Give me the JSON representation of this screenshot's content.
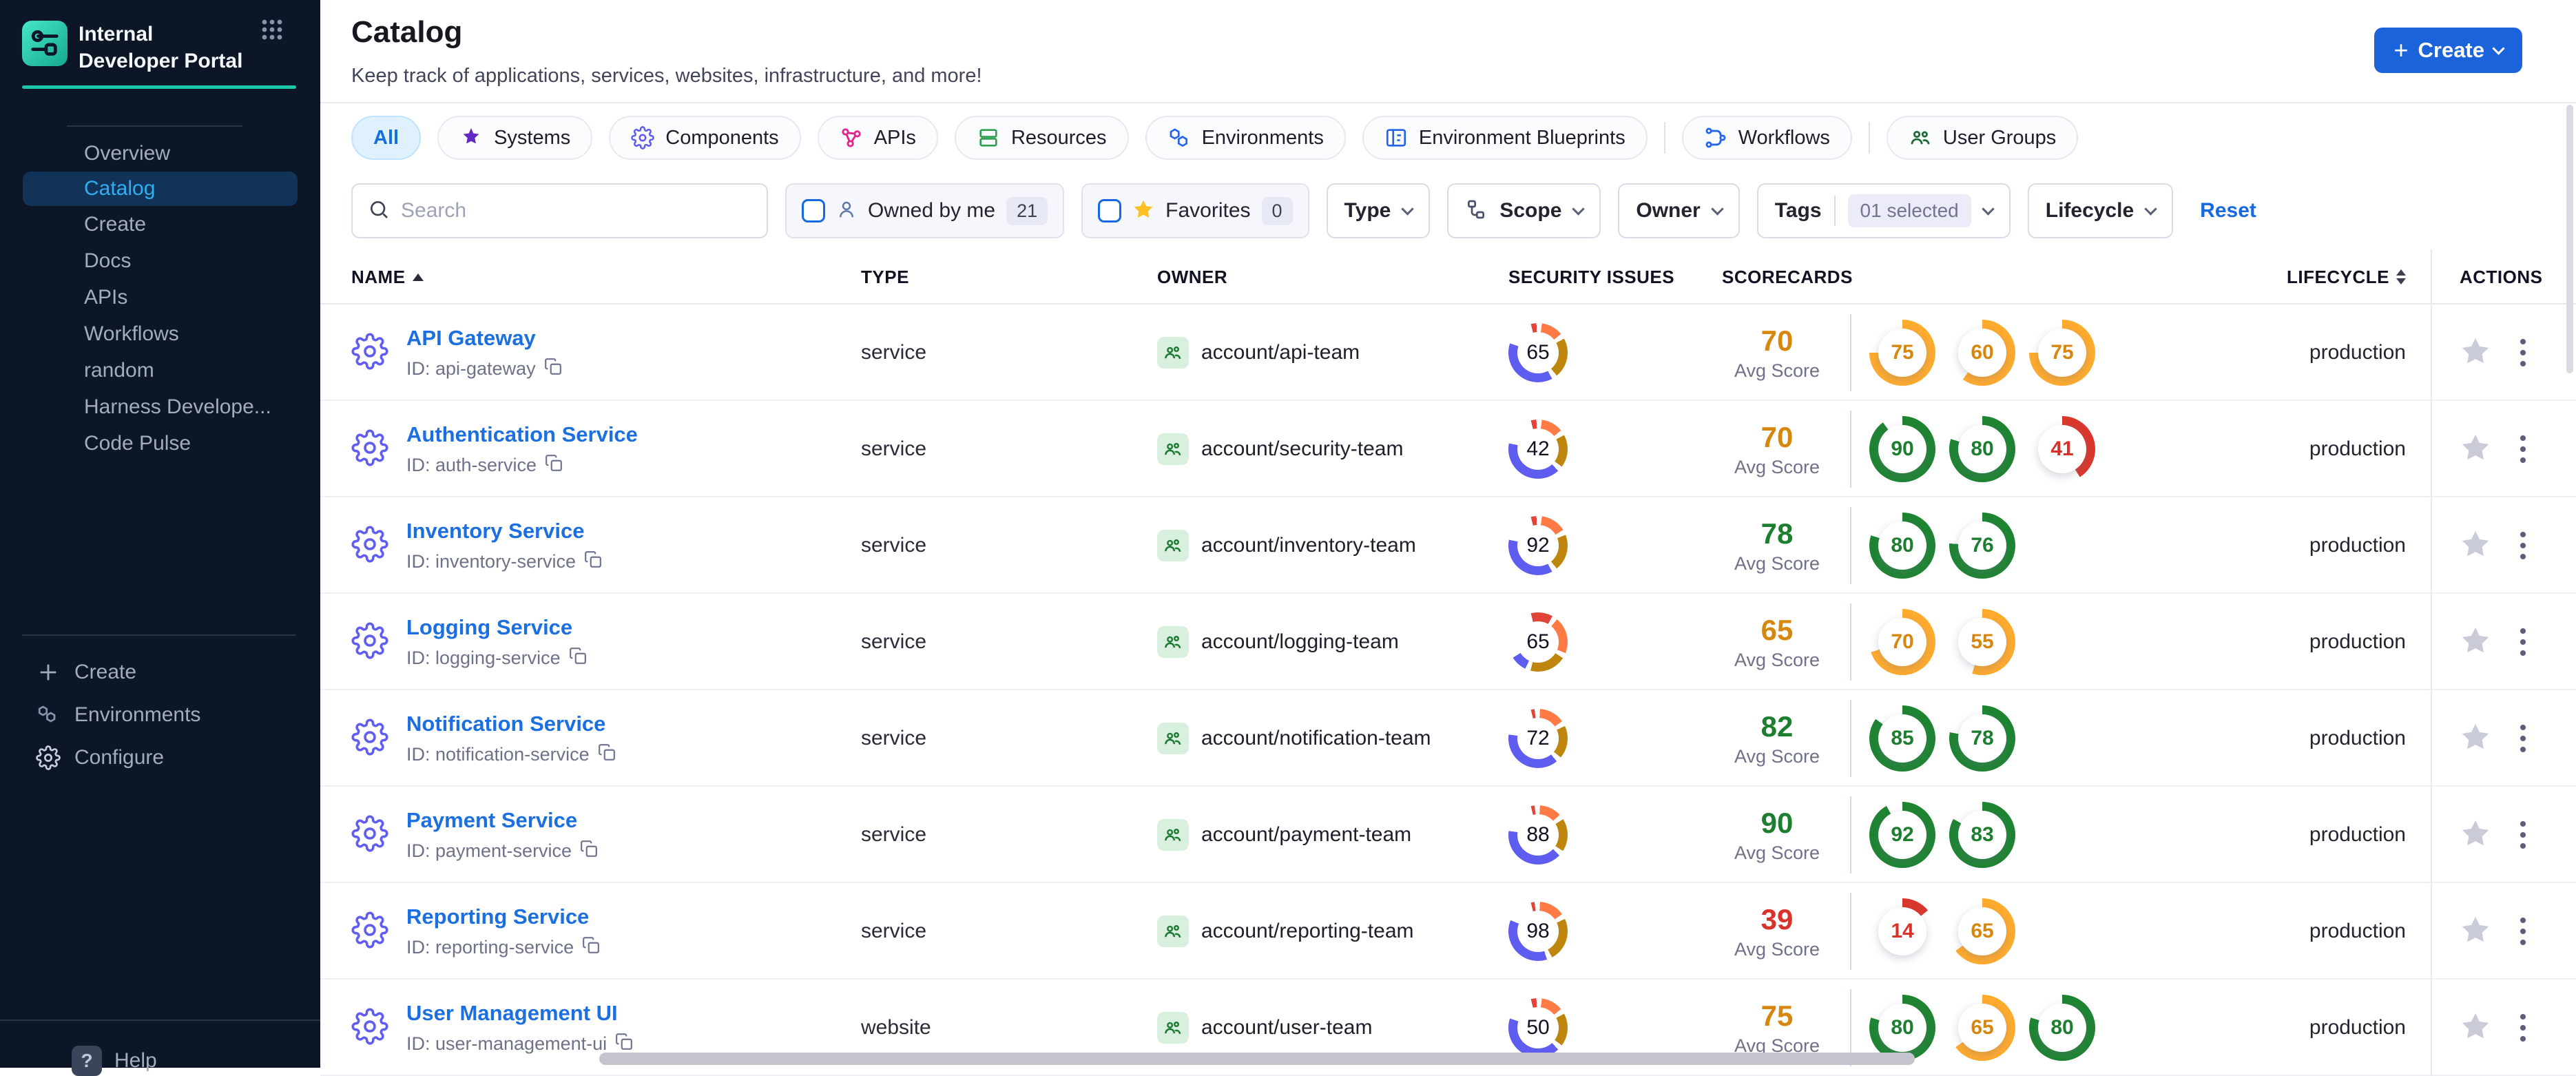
{
  "sidebar": {
    "logo_title": "Internal Developer Portal",
    "items": [
      {
        "label": "Overview",
        "active": false
      },
      {
        "label": "Catalog",
        "active": true
      },
      {
        "label": "Create",
        "active": false
      },
      {
        "label": "Docs",
        "active": false
      },
      {
        "label": "APIs",
        "active": false
      },
      {
        "label": "Workflows",
        "active": false
      },
      {
        "label": "random",
        "active": false
      },
      {
        "label": "Harness Develope...",
        "active": false
      },
      {
        "label": "Code Pulse",
        "active": false
      }
    ],
    "bottom_items": [
      {
        "icon": "plus-icon",
        "label": "Create"
      },
      {
        "icon": "hexagons-icon",
        "label": "Environments"
      },
      {
        "icon": "gear-icon",
        "label": "Configure"
      }
    ],
    "help_label": "Help"
  },
  "header": {
    "title": "Catalog",
    "subtitle": "Keep track of applications, services, websites, infrastructure, and more!",
    "create_label": "Create"
  },
  "tabs": [
    {
      "label": "All",
      "icon": "",
      "active": true,
      "divider_before": false
    },
    {
      "label": "Systems",
      "icon": "systems",
      "active": false,
      "divider_before": false
    },
    {
      "label": "Components",
      "icon": "components",
      "active": false,
      "divider_before": false
    },
    {
      "label": "APIs",
      "icon": "apis",
      "active": false,
      "divider_before": false
    },
    {
      "label": "Resources",
      "icon": "resources",
      "active": false,
      "divider_before": false
    },
    {
      "label": "Environments",
      "icon": "environments",
      "active": false,
      "divider_before": false
    },
    {
      "label": "Environment Blueprints",
      "icon": "blueprints",
      "active": false,
      "divider_before": false
    },
    {
      "label": "Workflows",
      "icon": "workflows",
      "active": false,
      "divider_before": true
    },
    {
      "label": "User Groups",
      "icon": "usergroups",
      "active": false,
      "divider_before": true
    }
  ],
  "filters": {
    "search_placeholder": "Search",
    "owned_by_me": {
      "label": "Owned by me",
      "count": "21"
    },
    "favorites": {
      "label": "Favorites",
      "count": "0"
    },
    "type_label": "Type",
    "scope_label": "Scope",
    "owner_label": "Owner",
    "tags": {
      "label": "Tags",
      "value": "01 selected"
    },
    "lifecycle_label": "Lifecycle",
    "reset_label": "Reset"
  },
  "table": {
    "columns": {
      "name": "NAME",
      "type": "TYPE",
      "owner": "OWNER",
      "security": "SECURITY ISSUES",
      "scorecards": "SCORECARDS",
      "lifecycle": "LIFECYCLE",
      "actions": "ACTIONS"
    },
    "avg_label": "Avg Score",
    "rows": [
      {
        "name": "API Gateway",
        "id": "ID: api-gateway",
        "type": "service",
        "owner": "account/api-team",
        "security": 65,
        "segments": [
          [
            "red",
            3
          ],
          [
            "orange",
            12
          ],
          [
            "gold",
            22
          ],
          [
            "blue",
            38
          ]
        ],
        "avg": 70,
        "avg_color": "orange",
        "scorecards": [
          [
            75,
            "orange"
          ],
          [
            60,
            "orange"
          ],
          [
            75,
            "orange"
          ]
        ],
        "lifecycle": "production"
      },
      {
        "name": "Authentication Service",
        "id": "ID: auth-service",
        "type": "service",
        "owner": "account/security-team",
        "security": 42,
        "segments": [
          [
            "red",
            3
          ],
          [
            "orange",
            12
          ],
          [
            "gold",
            18
          ],
          [
            "blue",
            40
          ]
        ],
        "avg": 70,
        "avg_color": "orange",
        "scorecards": [
          [
            90,
            "green"
          ],
          [
            80,
            "green"
          ],
          [
            41,
            "red"
          ]
        ],
        "lifecycle": "production"
      },
      {
        "name": "Inventory Service",
        "id": "ID: inventory-service",
        "type": "service",
        "owner": "account/inventory-team",
        "security": 92,
        "segments": [
          [
            "red",
            3
          ],
          [
            "orange",
            14
          ],
          [
            "gold",
            20
          ],
          [
            "blue",
            36
          ]
        ],
        "avg": 78,
        "avg_color": "green",
        "scorecards": [
          [
            80,
            "green"
          ],
          [
            76,
            "green"
          ]
        ],
        "lifecycle": "production"
      },
      {
        "name": "Logging Service",
        "id": "ID: logging-service",
        "type": "service",
        "owner": "account/logging-team",
        "security": 65,
        "segments": [
          [
            "red",
            12
          ],
          [
            "orange",
            20
          ],
          [
            "gold",
            20
          ],
          [
            "blue",
            9
          ]
        ],
        "avg": 65,
        "avg_color": "orange",
        "scorecards": [
          [
            70,
            "orange"
          ],
          [
            55,
            "orange"
          ]
        ],
        "lifecycle": "production"
      },
      {
        "name": "Notification Service",
        "id": "ID: notification-service",
        "type": "service",
        "owner": "account/notification-team",
        "security": 72,
        "segments": [
          [
            "red",
            2
          ],
          [
            "orange",
            14
          ],
          [
            "gold",
            18
          ],
          [
            "blue",
            38
          ]
        ],
        "avg": 82,
        "avg_color": "green",
        "scorecards": [
          [
            85,
            "green"
          ],
          [
            78,
            "green"
          ]
        ],
        "lifecycle": "production"
      },
      {
        "name": "Payment Service",
        "id": "ID: payment-service",
        "type": "service",
        "owner": "account/payment-team",
        "security": 88,
        "segments": [
          [
            "red",
            2
          ],
          [
            "orange",
            12
          ],
          [
            "gold",
            18
          ],
          [
            "blue",
            40
          ]
        ],
        "avg": 90,
        "avg_color": "green",
        "scorecards": [
          [
            92,
            "green"
          ],
          [
            83,
            "green"
          ]
        ],
        "lifecycle": "production"
      },
      {
        "name": "Reporting Service",
        "id": "ID: reporting-service",
        "type": "service",
        "owner": "account/reporting-team",
        "security": 98,
        "segments": [
          [
            "red",
            2
          ],
          [
            "orange",
            14
          ],
          [
            "gold",
            24
          ],
          [
            "blue",
            36
          ]
        ],
        "avg": 39,
        "avg_color": "red",
        "scorecards": [
          [
            14,
            "red"
          ],
          [
            65,
            "orange"
          ]
        ],
        "lifecycle": "production"
      },
      {
        "name": "User Management UI",
        "id": "ID: user-management-ui",
        "type": "website",
        "owner": "account/user-team",
        "security": 50,
        "segments": [
          [
            "red",
            3
          ],
          [
            "orange",
            12
          ],
          [
            "gold",
            18
          ],
          [
            "blue",
            42
          ]
        ],
        "avg": 75,
        "avg_color": "orange",
        "scorecards": [
          [
            80,
            "green"
          ],
          [
            65,
            "orange"
          ],
          [
            80,
            "green"
          ]
        ],
        "lifecycle": "production"
      }
    ]
  },
  "colors": {
    "accent_blue": "#1B63DB",
    "teal": "#1EC6A8",
    "active_nav": "#2FAEF2",
    "ring_green": "#1E8432",
    "ring_orange": "#FFAB2E",
    "ring_red": "#DA372C",
    "donut_blue": "#5F5CF0",
    "donut_gold": "#BE860D",
    "donut_orange": "#FF7A45",
    "donut_red": "#E04438"
  }
}
